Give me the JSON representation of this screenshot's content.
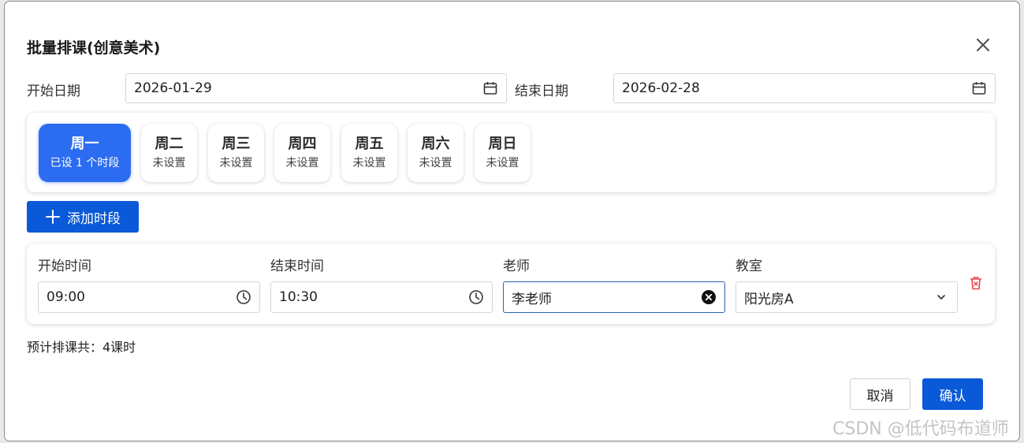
{
  "dialog": {
    "title": "批量排课(创意美术)",
    "close_icon": "close-icon"
  },
  "dates": {
    "start_label": "开始日期",
    "start_value": "2026-01-29",
    "end_label": "结束日期",
    "end_value": "2026-02-28",
    "calendar_icon": "calendar-icon"
  },
  "weekdays": [
    {
      "name": "周一",
      "status": "已设 1 个时段",
      "active": true
    },
    {
      "name": "周二",
      "status": "未设置",
      "active": false
    },
    {
      "name": "周三",
      "status": "未设置",
      "active": false
    },
    {
      "name": "周四",
      "status": "未设置",
      "active": false
    },
    {
      "name": "周五",
      "status": "未设置",
      "active": false
    },
    {
      "name": "周六",
      "status": "未设置",
      "active": false
    },
    {
      "name": "周日",
      "status": "未设置",
      "active": false
    }
  ],
  "add_slot": {
    "label": "添加时段",
    "icon": "plus-icon"
  },
  "slot": {
    "start_time_label": "开始时间",
    "start_time_value": "09:00",
    "end_time_label": "结束时间",
    "end_time_value": "10:30",
    "teacher_label": "老师",
    "teacher_value": "李老师",
    "room_label": "教室",
    "room_value": "阳光房A",
    "clock_icon": "clock-icon",
    "clear_icon": "clear-icon",
    "chevron_icon": "chevron-down-icon",
    "delete_icon": "trash-icon"
  },
  "summary": {
    "text": "预计排课共：4课时"
  },
  "footer": {
    "cancel_label": "取消",
    "confirm_label": "确认"
  },
  "watermark": "CSDN @低代码布道师",
  "colors": {
    "primary": "#0a59d8",
    "active_day": "#2c6cf0",
    "danger": "#e5484d"
  }
}
